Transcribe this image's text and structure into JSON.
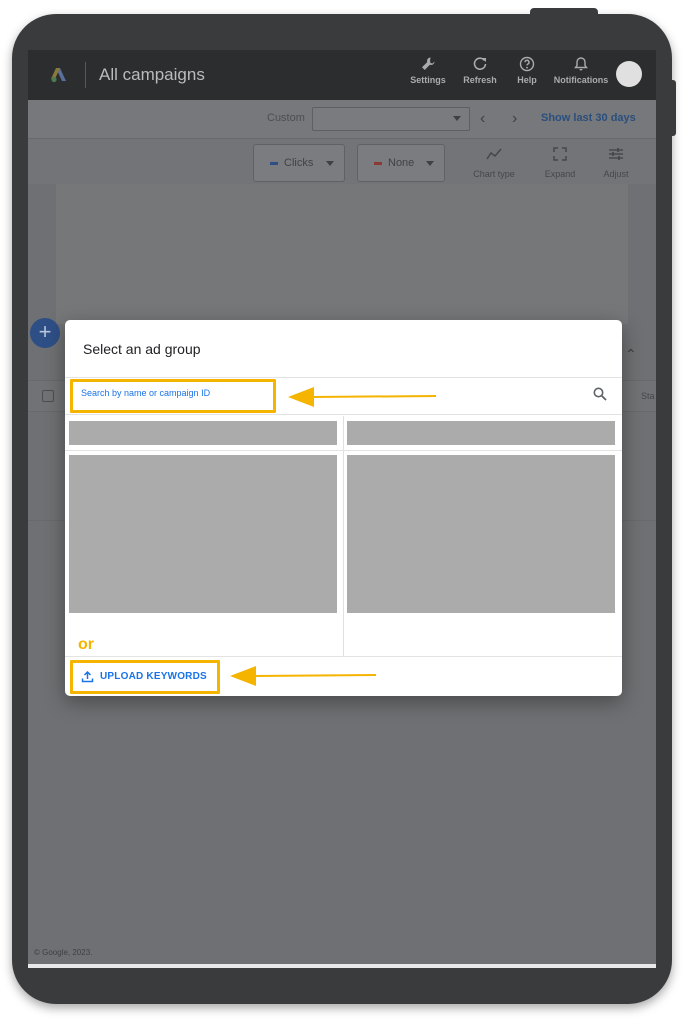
{
  "header": {
    "title": "All campaigns",
    "actions": [
      {
        "label": "Settings",
        "icon": "wrench-icon"
      },
      {
        "label": "Refresh",
        "icon": "refresh-icon"
      },
      {
        "label": "Help",
        "icon": "help-icon"
      },
      {
        "label": "Notifications",
        "icon": "bell-icon"
      }
    ]
  },
  "date_range": {
    "label": "Custom",
    "selected_value": "",
    "show_last_label": "Show last 30 days"
  },
  "chart_controls": {
    "metric_1": "Clicks",
    "metric_2": "None",
    "tools": [
      {
        "label": "Chart type",
        "icon": "line-chart-icon"
      },
      {
        "label": "Expand",
        "icon": "expand-icon"
      },
      {
        "label": "Adjust",
        "icon": "sliders-icon"
      }
    ]
  },
  "table": {
    "status_header": "Sta"
  },
  "modal": {
    "title": "Select an ad group",
    "search_placeholder": "Search by name or campaign ID",
    "or_label": "or",
    "upload_label": "UPLOAD KEYWORDS"
  },
  "footer": {
    "copyright": "© Google, 2023."
  },
  "colors": {
    "highlight": "#f4b400",
    "link": "#1a73e8",
    "header_bg": "#2c2d2f",
    "overlay": "#6f7073"
  }
}
